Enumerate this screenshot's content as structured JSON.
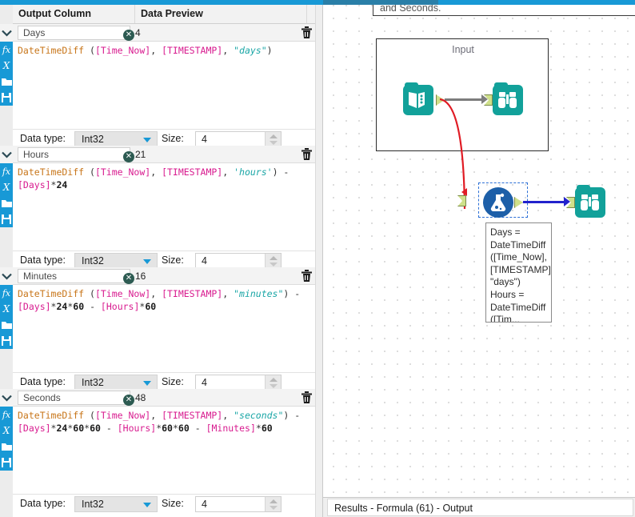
{
  "grid": {
    "header": {
      "output_column": "Output Column",
      "data_preview": "Data Preview"
    },
    "labels": {
      "data_type": "Data type:",
      "size": "Size:",
      "clear_icon": "clear-circle-icon",
      "delete_icon": "trash-icon",
      "expand_icon": "chevron-down-icon"
    },
    "rail_icons": [
      "fx-icon",
      "variable-x-icon",
      "open-folder-icon",
      "save-disk-icon"
    ],
    "sections": [
      {
        "name": "Days",
        "preview": "4",
        "data_type": "Int32",
        "size": "4",
        "formula_tokens": [
          {
            "t": "DateTimeDiff",
            "c": "fn"
          },
          {
            "t": " (",
            "c": "punc"
          },
          {
            "t": "[Time_Now]",
            "c": "fld"
          },
          {
            "t": ", ",
            "c": "punc"
          },
          {
            "t": "[TIMESTAMP]",
            "c": "fld"
          },
          {
            "t": ", ",
            "c": "punc"
          },
          {
            "t": "\"days\"",
            "c": "str"
          },
          {
            "t": ")",
            "c": "punc"
          }
        ]
      },
      {
        "name": "Hours",
        "preview": "21",
        "data_type": "Int32",
        "size": "4",
        "formula_tokens": [
          {
            "t": "DateTimeDiff",
            "c": "fn"
          },
          {
            "t": " (",
            "c": "punc"
          },
          {
            "t": "[Time_Now]",
            "c": "fld"
          },
          {
            "t": ", ",
            "c": "punc"
          },
          {
            "t": "[TIMESTAMP]",
            "c": "fld"
          },
          {
            "t": ", ",
            "c": "punc"
          },
          {
            "t": "'hours'",
            "c": "str"
          },
          {
            "t": ") ",
            "c": "punc"
          },
          {
            "t": "- ",
            "c": "op"
          },
          {
            "t": "[Days]",
            "c": "fld"
          },
          {
            "t": "*",
            "c": "op"
          },
          {
            "t": "24",
            "c": "num"
          }
        ]
      },
      {
        "name": "Minutes",
        "preview": "16",
        "data_type": "Int32",
        "size": "4",
        "formula_tokens": [
          {
            "t": "DateTimeDiff",
            "c": "fn"
          },
          {
            "t": " (",
            "c": "punc"
          },
          {
            "t": "[Time_Now]",
            "c": "fld"
          },
          {
            "t": ", ",
            "c": "punc"
          },
          {
            "t": "[TIMESTAMP]",
            "c": "fld"
          },
          {
            "t": ", ",
            "c": "punc"
          },
          {
            "t": "\"minutes\"",
            "c": "str"
          },
          {
            "t": ") ",
            "c": "punc"
          },
          {
            "t": "- ",
            "c": "op"
          },
          {
            "t": "[Days]",
            "c": "fld"
          },
          {
            "t": "*",
            "c": "op"
          },
          {
            "t": "24",
            "c": "num"
          },
          {
            "t": "*",
            "c": "op"
          },
          {
            "t": "60",
            "c": "num"
          },
          {
            "t": " - ",
            "c": "op"
          },
          {
            "t": "[Hours]",
            "c": "fld"
          },
          {
            "t": "*",
            "c": "op"
          },
          {
            "t": "60",
            "c": "num"
          }
        ]
      },
      {
        "name": "Seconds",
        "preview": "48",
        "data_type": "Int32",
        "size": "4",
        "formula_tokens": [
          {
            "t": "DateTimeDiff",
            "c": "fn"
          },
          {
            "t": " (",
            "c": "punc"
          },
          {
            "t": "[Time_Now]",
            "c": "fld"
          },
          {
            "t": ", ",
            "c": "punc"
          },
          {
            "t": "[TIMESTAMP]",
            "c": "fld"
          },
          {
            "t": ", ",
            "c": "punc"
          },
          {
            "t": "\"seconds\"",
            "c": "str"
          },
          {
            "t": ") ",
            "c": "punc"
          },
          {
            "t": "- ",
            "c": "op"
          },
          {
            "t": "[Days]",
            "c": "fld"
          },
          {
            "t": "*",
            "c": "op"
          },
          {
            "t": "24",
            "c": "num"
          },
          {
            "t": "*",
            "c": "op"
          },
          {
            "t": "60",
            "c": "num"
          },
          {
            "t": "*",
            "c": "op"
          },
          {
            "t": "60",
            "c": "num"
          },
          {
            "t": " - ",
            "c": "op"
          },
          {
            "t": "[Hours]",
            "c": "fld"
          },
          {
            "t": "*",
            "c": "op"
          },
          {
            "t": "60",
            "c": "num"
          },
          {
            "t": "*",
            "c": "op"
          },
          {
            "t": "60",
            "c": "num"
          },
          {
            "t": " - ",
            "c": "op"
          },
          {
            "t": "[Minutes]",
            "c": "fld"
          },
          {
            "t": "*",
            "c": "op"
          },
          {
            "t": "60",
            "c": "num"
          }
        ]
      }
    ]
  },
  "canvas": {
    "comment_text": "and Seconds.",
    "container_label": "Input",
    "tooltip_text": "Days = DateTimeDiff ([Time_Now], [TIMESTAMP], \"days\") Hours = DateTimeDiff ([Tim...",
    "tools": {
      "text_input": "text-input-tool",
      "browse_top": "browse-tool",
      "formula": "formula-tool",
      "browse_bottom": "browse-tool"
    }
  },
  "status": {
    "text": "Results - Formula (61) - Output"
  },
  "colors": {
    "accent_blue": "#1899d6",
    "tool_teal": "#12a19a",
    "formula_blue": "#1d5fa8",
    "wire_error_red": "#e01b24",
    "wire_gray": "#7d7d7d",
    "wire_blue": "#2222cc",
    "function_orange": "#c8761a",
    "field_magenta": "#d81b8f",
    "string_teal": "#1aa6a6"
  }
}
